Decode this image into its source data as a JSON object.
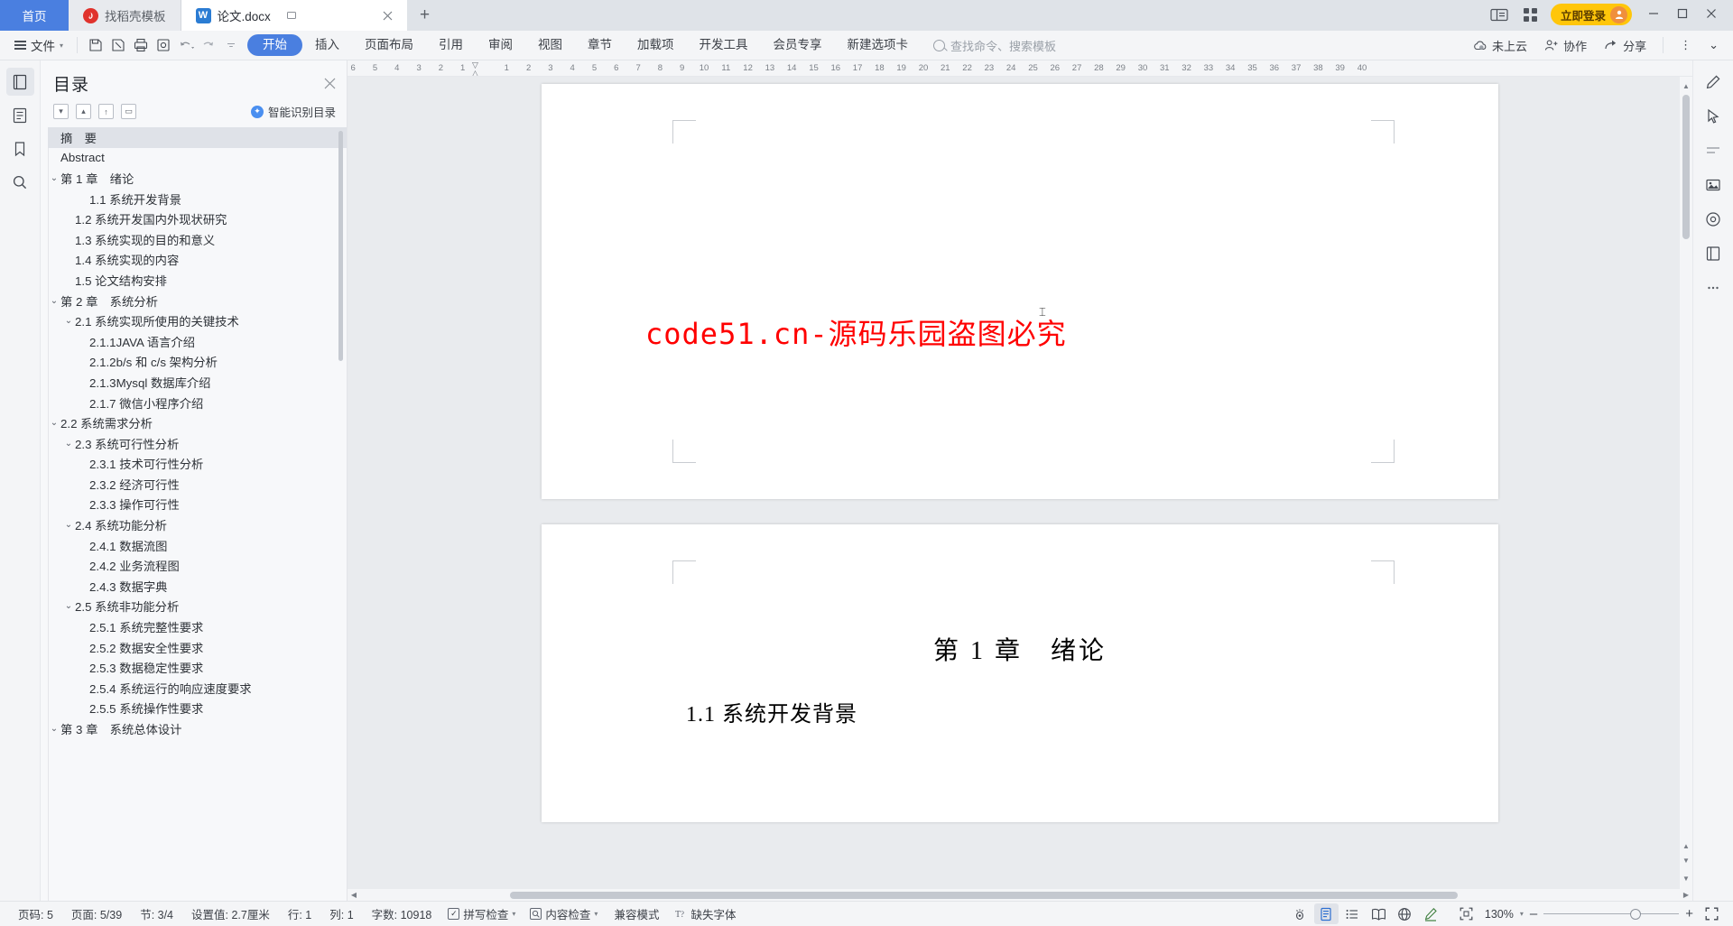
{
  "tabbar": {
    "home": "首页",
    "tabs": [
      {
        "label": "找稻壳模板",
        "icon": "docer-icon"
      },
      {
        "label": "论文.docx",
        "icon": "word-icon"
      }
    ],
    "new_tab": "+",
    "login": "立即登录",
    "minimize": "–",
    "maximize": "□",
    "close": "✕"
  },
  "ribbon": {
    "file": "文件",
    "quick": [
      "save-icon",
      "save-as-icon",
      "print-icon",
      "print-preview-icon",
      "undo-icon",
      "redo-icon",
      "customize-icon"
    ],
    "tabs": [
      {
        "label": "开始",
        "selected": true
      },
      {
        "label": "插入",
        "selected": false
      },
      {
        "label": "页面布局",
        "selected": false
      },
      {
        "label": "引用",
        "selected": false
      },
      {
        "label": "审阅",
        "selected": false
      },
      {
        "label": "视图",
        "selected": false
      },
      {
        "label": "章节",
        "selected": false
      },
      {
        "label": "加载项",
        "selected": false
      },
      {
        "label": "开发工具",
        "selected": false
      },
      {
        "label": "会员专享",
        "selected": false
      },
      {
        "label": "新建选项卡",
        "selected": false
      }
    ],
    "search_placeholder": "查找命令、搜索模板",
    "right": [
      {
        "label": "未上云",
        "icon": "cloud-icon"
      },
      {
        "label": "协作",
        "icon": "collaborate-icon"
      },
      {
        "label": "分享",
        "icon": "share-icon"
      }
    ],
    "more": "⋮",
    "collapse": "⌄"
  },
  "left_rail": [
    {
      "name": "page-thumbnails-icon",
      "active": true
    },
    {
      "name": "document-outline-icon",
      "active": false
    },
    {
      "name": "bookmark-icon",
      "active": false
    },
    {
      "name": "search-icon",
      "active": false
    }
  ],
  "right_rail": [
    {
      "name": "pen-edit-icon"
    },
    {
      "name": "cursor-select-icon"
    },
    {
      "name": "divider-icon"
    },
    {
      "name": "image-tool-icon"
    },
    {
      "name": "shape-tool-icon"
    },
    {
      "name": "page-layout-icon"
    },
    {
      "name": "more-dots-icon"
    }
  ],
  "toc": {
    "title": "目录",
    "close": "✕",
    "tools": [
      "collapse-all-icon",
      "expand-up-icon",
      "expand-down-icon",
      "level-icon"
    ],
    "smart_label": "智能识别目录",
    "items": [
      {
        "label": "摘　要",
        "indent": 0,
        "twisty": "",
        "selected": true
      },
      {
        "label": "Abstract",
        "indent": 0,
        "twisty": "",
        "selected": false
      },
      {
        "label": "第 1 章　绪论",
        "indent": 0,
        "twisty": "v",
        "selected": false
      },
      {
        "label": "1.1 系统开发背景",
        "indent": 2,
        "twisty": "",
        "selected": false
      },
      {
        "label": "1.2 系统开发国内外现状研究",
        "indent": 1,
        "twisty": "",
        "selected": false
      },
      {
        "label": "1.3 系统实现的目的和意义",
        "indent": 1,
        "twisty": "",
        "selected": false
      },
      {
        "label": "1.4 系统实现的内容",
        "indent": 1,
        "twisty": "",
        "selected": false
      },
      {
        "label": "1.5 论文结构安排",
        "indent": 1,
        "twisty": "",
        "selected": false
      },
      {
        "label": "第 2 章　系统分析",
        "indent": 0,
        "twisty": "v",
        "selected": false
      },
      {
        "label": "2.1 系统实现所使用的关键技术",
        "indent": 1,
        "twisty": "v",
        "selected": false
      },
      {
        "label": "2.1.1JAVA 语言介绍",
        "indent": 2,
        "twisty": "",
        "selected": false
      },
      {
        "label": "2.1.2b/s 和 c/s 架构分析",
        "indent": 2,
        "twisty": "",
        "selected": false
      },
      {
        "label": "2.1.3Mysql 数据库介绍",
        "indent": 2,
        "twisty": "",
        "selected": false
      },
      {
        "label": "2.1.7 微信小程序介绍",
        "indent": 2,
        "twisty": "",
        "selected": false
      },
      {
        "label": "2.2 系统需求分析",
        "indent": 0,
        "twisty": "v",
        "selected": false
      },
      {
        "label": "2.3 系统可行性分析",
        "indent": 1,
        "twisty": "v",
        "selected": false
      },
      {
        "label": "2.3.1 技术可行性分析",
        "indent": 2,
        "twisty": "",
        "selected": false
      },
      {
        "label": "2.3.2 经济可行性",
        "indent": 2,
        "twisty": "",
        "selected": false
      },
      {
        "label": "2.3.3 操作可行性",
        "indent": 2,
        "twisty": "",
        "selected": false
      },
      {
        "label": "2.4 系统功能分析",
        "indent": 1,
        "twisty": "v",
        "selected": false
      },
      {
        "label": "2.4.1 数据流图",
        "indent": 2,
        "twisty": "",
        "selected": false
      },
      {
        "label": "2.4.2  业务流程图",
        "indent": 2,
        "twisty": "",
        "selected": false
      },
      {
        "label": "2.4.3 数据字典",
        "indent": 2,
        "twisty": "",
        "selected": false
      },
      {
        "label": "2.5  系统非功能分析",
        "indent": 1,
        "twisty": "v",
        "selected": false
      },
      {
        "label": "2.5.1 系统完整性要求",
        "indent": 2,
        "twisty": "",
        "selected": false
      },
      {
        "label": "2.5.2 数据安全性要求",
        "indent": 2,
        "twisty": "",
        "selected": false
      },
      {
        "label": "2.5.3 数据稳定性要求",
        "indent": 2,
        "twisty": "",
        "selected": false
      },
      {
        "label": "2.5.4 系统运行的响应速度要求",
        "indent": 2,
        "twisty": "",
        "selected": false
      },
      {
        "label": "2.5.5 系统操作性要求",
        "indent": 2,
        "twisty": "",
        "selected": false
      },
      {
        "label": "第 3 章　系统总体设计",
        "indent": 0,
        "twisty": "v",
        "selected": false
      }
    ]
  },
  "ruler": {
    "left_marks": [
      6,
      5,
      4,
      3,
      2,
      1
    ],
    "right_marks": [
      1,
      2,
      3,
      4,
      5,
      6,
      7,
      8,
      9,
      10,
      11,
      12,
      13,
      14,
      15,
      16,
      17,
      18,
      19,
      20,
      21,
      22,
      23,
      24,
      25,
      26,
      27,
      28,
      29,
      30,
      31,
      32,
      33,
      34,
      35,
      36,
      37,
      38,
      39,
      40
    ]
  },
  "document": {
    "watermark": "code51.cn-源码乐园盗图必究",
    "heading1": "第 1 章　绪论",
    "heading2": "1.1 系统开发背景"
  },
  "status": {
    "page_no_label": "页码: 5",
    "page_label": "页面: 5/39",
    "section_label": "节: 3/4",
    "setting_label": "设置值: 2.7厘米",
    "row_label": "行: 1",
    "col_label": "列: 1",
    "words_label": "字数: 10918",
    "spellcheck_label": "拼写检查",
    "contentcheck_label": "内容检查",
    "compat_label": "兼容模式",
    "missing_font_label": "缺失字体",
    "zoom_label": "130%",
    "zoom_minus": "–",
    "zoom_plus": "+",
    "views": [
      "eye-protection-icon",
      "page-view-icon",
      "outline-view-icon",
      "reading-view-icon",
      "web-view-icon",
      "highlight-icon"
    ],
    "fullscreen": "fullscreen-icon"
  },
  "colors": {
    "accent": "#4a7fe0",
    "login": "#ffc60a",
    "watermark": "#ff0000",
    "tabbar_bg": "#dfe3e8"
  }
}
